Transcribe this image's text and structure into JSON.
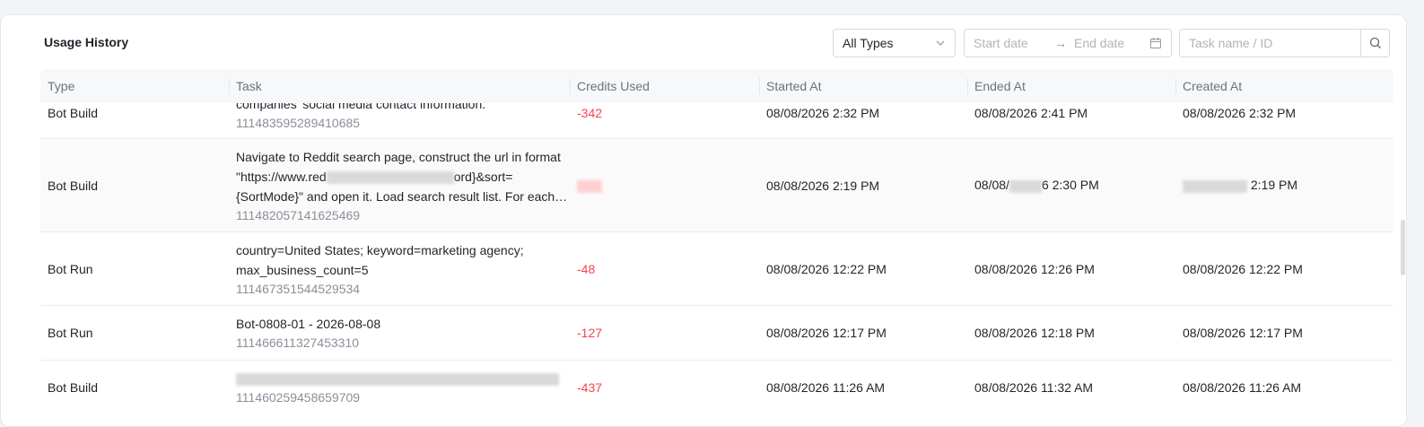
{
  "header": {
    "title": "Usage History"
  },
  "filters": {
    "type_select": "All Types",
    "start_date_placeholder": "Start date",
    "arrow": "→",
    "end_date_placeholder": "End date",
    "search_placeholder": "Task name / ID"
  },
  "table": {
    "columns": [
      "Type",
      "Task",
      "Credits Used",
      "Started At",
      "Ended At",
      "Created At"
    ],
    "rows": [
      {
        "type": "Bot Build",
        "task_lines": [
          "companies' social media contact information."
        ],
        "task_id": "111483595289410685",
        "credits": "-342",
        "started": "08/08/2026 2:32 PM",
        "ended": "08/08/2026 2:41 PM",
        "created": "08/08/2026 2:32 PM"
      },
      {
        "type": "Bot Build",
        "task_lines": [
          "Navigate to Reddit search page, construct the url in format",
          "\"https://www.red",
          "ord}&sort=",
          "{SortMode}\" and open it. Load search result list. For each…"
        ],
        "task_id": "111482057141625469",
        "credits": "",
        "started": "08/08/2026 2:19 PM",
        "ended_prefix": "08/08/",
        "ended_suffix": "6 2:30 PM",
        "created_suffix": "2:19 PM"
      },
      {
        "type": "Bot Run",
        "task_lines": [
          "country=United States; keyword=marketing agency;",
          "max_business_count=5"
        ],
        "task_id": "111467351544529534",
        "credits": "-48",
        "started": "08/08/2026 12:22 PM",
        "ended": "08/08/2026 12:26 PM",
        "created": "08/08/2026 12:22 PM"
      },
      {
        "type": "Bot Run",
        "task_lines": [
          "Bot-0808-01 - 2026-08-08"
        ],
        "task_id": "111466611327453310",
        "credits": "-127",
        "started": "08/08/2026 12:17 PM",
        "ended": "08/08/2026 12:18 PM",
        "created": "08/08/2026 12:17 PM"
      },
      {
        "type": "Bot Build",
        "task_lines": [
          ""
        ],
        "task_id": "111460259458659709",
        "credits": "-437",
        "started": "08/08/2026 11:26 AM",
        "ended": "08/08/2026 11:32 AM",
        "created": "08/08/2026 11:26 AM"
      }
    ]
  },
  "icons": {
    "chevron": "chevron-down-icon",
    "calendar": "calendar-icon",
    "search": "search-icon"
  },
  "colors": {
    "credits_negative": "#f5424e",
    "header_bg": "#f7f8fa",
    "muted_text": "#8a8f99"
  }
}
